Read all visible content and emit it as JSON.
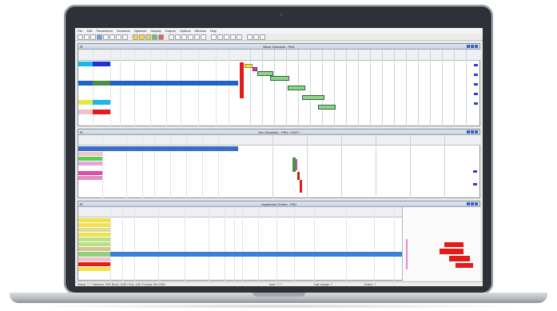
{
  "menu": [
    "File",
    "Edit",
    "Parameters",
    "Schedule",
    "Optimize",
    "Display",
    "Graphs",
    "Options",
    "Window",
    "Help"
  ],
  "panes": {
    "block": {
      "title": "Block Schedule - PM1"
    },
    "run": {
      "title": "Run Schedule - PM1 / 1042?"
    },
    "orders": {
      "title": "Unplanned Orders - PM1"
    }
  },
  "colors": {
    "selection": "#1f63c8",
    "bar_green": "#8dd28d",
    "flag_blue": "#2a3fd3",
    "red_block": "#e31b1b"
  },
  "statusbar": {
    "left": "Virtual: ? / ?   Machine: PM1   Block: 1042?   Run: 104?   Product: BK-G060",
    "mid": "Sum: ? / ?",
    "right1": "Last change: ?",
    "right2": "Orders: ?"
  }
}
